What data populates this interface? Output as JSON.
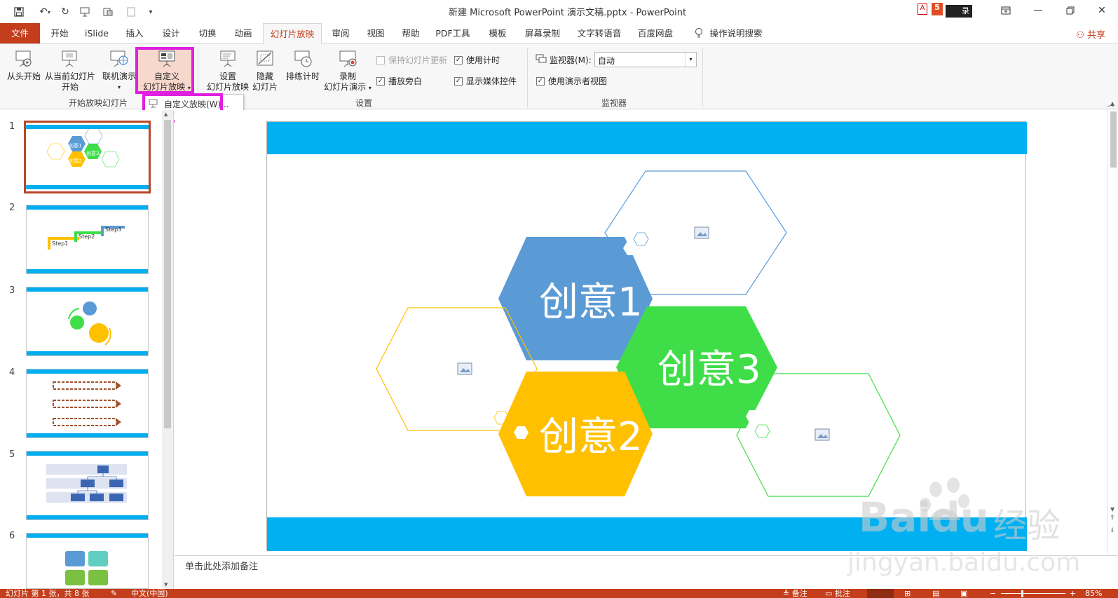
{
  "window": {
    "title": "新建 Microsoft PowerPoint 演示文稿.pptx  -  PowerPoint",
    "login_label": "录"
  },
  "tabs": [
    "文件",
    "开始",
    "iSlide",
    "插入",
    "设计",
    "切换",
    "动画",
    "幻灯片放映",
    "审阅",
    "视图",
    "帮助",
    "PDF工具",
    "模板",
    "屏幕录制",
    "文字转语音",
    "百度网盘"
  ],
  "tell_me": "操作说明搜索",
  "share": "共享",
  "ribbon": {
    "from_beginning": "从头开始",
    "from_current_1": "从当前幻灯片",
    "from_current_2": "开始",
    "online": "联机演示",
    "custom_1": "自定义",
    "custom_2": "幻灯片放映",
    "group_start": "开始放映幻灯片",
    "setup_1": "设置",
    "setup_2": "幻灯片放映",
    "hide_1": "隐藏",
    "hide_2": "幻灯片",
    "rehearse": "排练计时",
    "record_1": "录制",
    "record_2": "幻灯片演示",
    "keep_updated": "保持幻灯片更新",
    "play_narration": "播放旁白",
    "use_timings": "使用计时",
    "show_media": "显示媒体控件",
    "group_setup": "设置",
    "monitor_label": "监视器(M):",
    "monitor_value": "自动",
    "presenter_view": "使用演示者视图",
    "group_monitor": "监视器"
  },
  "dropdown_item": "自定义放映(W)...",
  "slides": [
    {
      "num": "1",
      "labels": [
        "创意1",
        "创意2",
        "创意3"
      ]
    },
    {
      "num": "2",
      "labels": [
        "Step1",
        "Step2",
        "Step3"
      ]
    },
    {
      "num": "3"
    },
    {
      "num": "4"
    },
    {
      "num": "5"
    },
    {
      "num": "6"
    }
  ],
  "slide": {
    "hex1": "创意1",
    "hex2": "创意2",
    "hex3": "创意3",
    "colors": {
      "blue": "#5b9bd5",
      "yellow": "#ffc000",
      "green": "#3fde49",
      "bar": "#00b0f0"
    }
  },
  "notes_placeholder": "单击此处添加备注",
  "status": {
    "slide_info": "幻灯片 第 1 张，共 8 张",
    "language": "中文(中国)",
    "notes": "备注",
    "comments": "批注",
    "zoom": "85%"
  },
  "watermark": {
    "brand": "Baidu",
    "suffix": "经验",
    "url": "jingyan.baidu.com"
  }
}
